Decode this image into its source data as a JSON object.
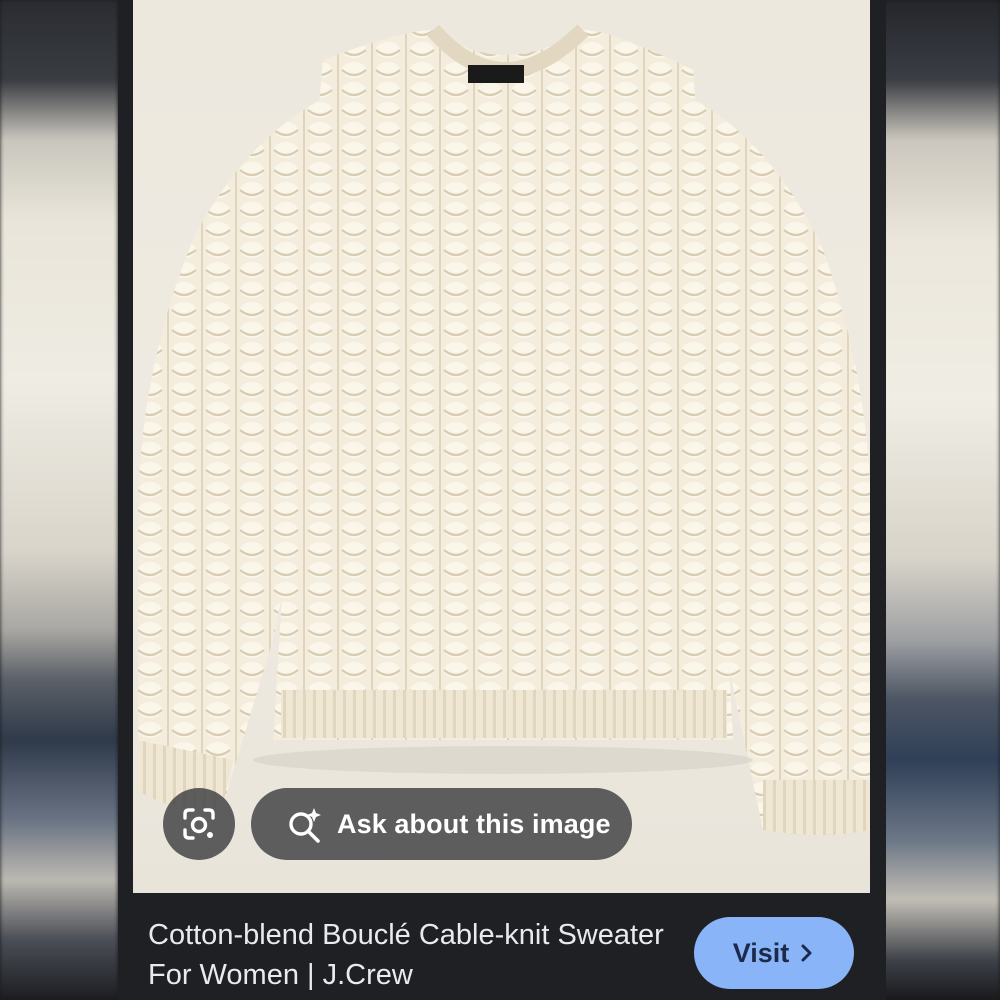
{
  "image_viewer": {
    "ask_button_label": "Ask about this image",
    "result_title": "Cotton-blend Bouclé Cable-knit Sweater For Women | J.Crew",
    "visit_label": "Visit"
  },
  "icons": {
    "lens": "google-lens-icon",
    "ask": "sparkle-search-icon",
    "visit_chevron": "chevron-right-icon"
  },
  "colors": {
    "accent": "#8ab4f8",
    "overlay": "#464648",
    "sweater": "#f3ecdc"
  }
}
